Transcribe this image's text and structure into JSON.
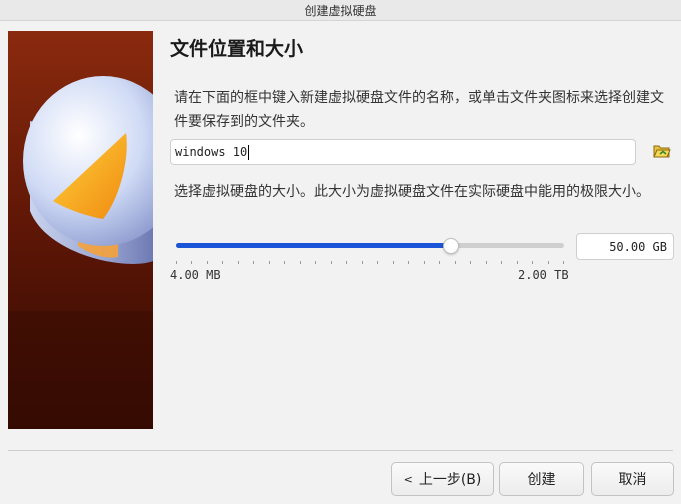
{
  "window": {
    "title": "创建虚拟硬盘"
  },
  "page": {
    "heading": "文件位置和大小",
    "location_description": "请在下面的框中键入新建虚拟硬盘文件的名称，或单击文件夹图标来选择创建文件要保存到的文件夹。",
    "size_description": "选择虚拟硬盘的大小。此大小为虚拟硬盘文件在实际硬盘中能用的极限大小。"
  },
  "file": {
    "name_value": "windows 10"
  },
  "size": {
    "value_text": "50.00 GB",
    "min_label": "4.00 MB",
    "max_label": "2.00 TB",
    "slider_fraction": 0.705
  },
  "buttons": {
    "back_label": "上一步(B)",
    "create_label": "创建",
    "cancel_label": "取消"
  },
  "icons": {
    "folder": "folder-icon",
    "back_arrow": "chevron-left-icon",
    "side_art": "virtual-disk-illustration"
  },
  "colors": {
    "accent": "#1a55d8",
    "side_background": "#7a1f08"
  }
}
